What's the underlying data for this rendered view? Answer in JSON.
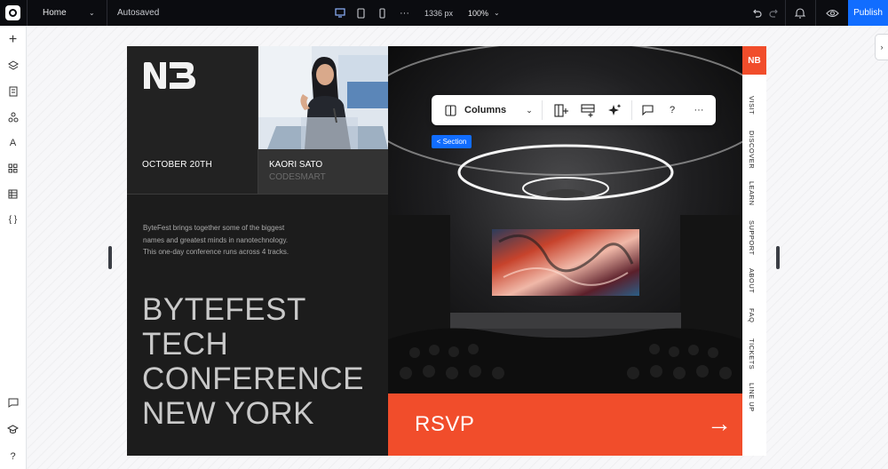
{
  "topbar": {
    "page": "Home",
    "status": "Autosaved",
    "width_readout": "1336 px",
    "zoom": "100%",
    "publish_label": "Publish"
  },
  "toolbar": {
    "layout_label": "Columns",
    "help_label": "?",
    "more_label": "···"
  },
  "section_badge": "< Section",
  "site": {
    "logo_text": "NB",
    "date": "OCTOBER 20TH",
    "speaker_name": "KAORI SATO",
    "speaker_company": "CODESMART",
    "blurb_lines": [
      "ByteFest brings together some of the biggest",
      "names and greatest minds in nanotechnology.",
      "This one-day conference runs across 4 tracks."
    ],
    "headline_lines": [
      "BYTEFEST",
      "TECH",
      "CONFERENCE",
      "NEW YORK"
    ],
    "rsvp_label": "RSVP",
    "rsvp_arrow": "→",
    "nav_logo": "NB",
    "nav_items": [
      "VISIT",
      "DISCOVER",
      "LEARN",
      "SUPPORT",
      "ABOUT",
      "FAQ",
      "TICKETS",
      "LINE UP"
    ]
  },
  "colors": {
    "accent": "#f14d2b",
    "editor_blue": "#116dff",
    "topbar_bg": "#0b0c10"
  }
}
